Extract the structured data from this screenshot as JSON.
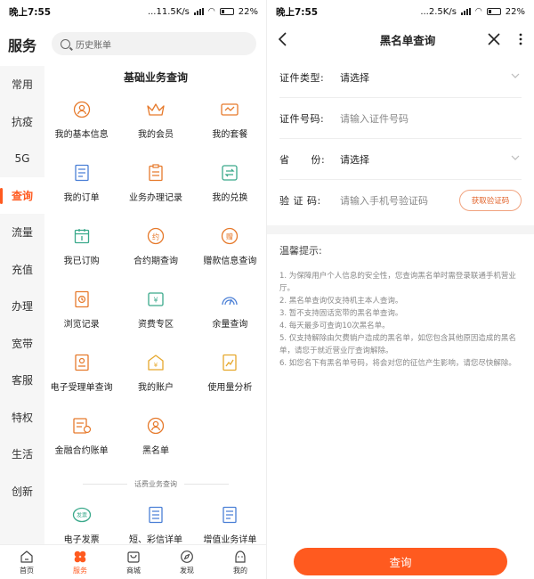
{
  "left": {
    "status": {
      "time": "晚上7:55",
      "speed": "...11.5K/s",
      "battery": "22%"
    },
    "sidebar": {
      "title": "服务",
      "items": [
        {
          "label": "常用"
        },
        {
          "label": "抗疫"
        },
        {
          "label": "5G"
        },
        {
          "label": "查询",
          "active": true
        },
        {
          "label": "流量"
        },
        {
          "label": "充值"
        },
        {
          "label": "办理"
        },
        {
          "label": "宽带"
        },
        {
          "label": "客服"
        },
        {
          "label": "特权"
        },
        {
          "label": "生活"
        },
        {
          "label": "创新"
        }
      ]
    },
    "search": {
      "placeholder": "历史账单"
    },
    "section_title": "基础业务查询",
    "grid": [
      {
        "label": "我的基本信息",
        "icon": "person-icon"
      },
      {
        "label": "我的会员",
        "icon": "crown-icon"
      },
      {
        "label": "我的套餐",
        "icon": "package-icon"
      },
      {
        "label": "我的订单",
        "icon": "order-list-icon"
      },
      {
        "label": "业务办理记录",
        "icon": "clipboard-icon"
      },
      {
        "label": "我的兑换",
        "icon": "exchange-icon"
      },
      {
        "label": "我已订购",
        "icon": "calendar-icon"
      },
      {
        "label": "合约期查询",
        "icon": "contract-icon"
      },
      {
        "label": "赠款信息查询",
        "icon": "gift-money-icon"
      },
      {
        "label": "浏览记录",
        "icon": "history-icon"
      },
      {
        "label": "资费专区",
        "icon": "tariff-icon"
      },
      {
        "label": "余量查询",
        "icon": "gauge-icon"
      },
      {
        "label": "电子受理单查询",
        "icon": "receipt-icon"
      },
      {
        "label": "我的账户",
        "icon": "account-icon"
      },
      {
        "label": "使用量分析",
        "icon": "analysis-icon"
      },
      {
        "label": "金融合约账单",
        "icon": "finance-bill-icon"
      },
      {
        "label": "黑名单",
        "icon": "blacklist-icon"
      }
    ],
    "sub_section_title": "话费业务查询",
    "grid2": [
      {
        "label": "电子发票",
        "icon": "invoice-icon"
      },
      {
        "label": "短、彩信详单",
        "icon": "sms-detail-icon"
      },
      {
        "label": "增值业务详单",
        "icon": "vas-detail-icon"
      }
    ],
    "tabbar": [
      {
        "label": "首页",
        "icon": "home-icon"
      },
      {
        "label": "服务",
        "icon": "service-icon",
        "active": true
      },
      {
        "label": "商城",
        "icon": "shop-icon"
      },
      {
        "label": "发现",
        "icon": "discover-icon"
      },
      {
        "label": "我的",
        "icon": "profile-icon"
      }
    ]
  },
  "right": {
    "status": {
      "time": "晚上7:55",
      "speed": "...2.5K/s",
      "battery": "22%"
    },
    "nav": {
      "title": "黑名单查询"
    },
    "form": {
      "id_type": {
        "label": "证件类型:",
        "value": "请选择"
      },
      "id_number": {
        "label": "证件号码:",
        "placeholder": "请输入证件号码"
      },
      "province": {
        "label": "省      份:",
        "value": "请选择"
      },
      "code": {
        "label": "验 证 码:",
        "placeholder": "请输入手机号验证码",
        "button": "获取验证码"
      }
    },
    "tips": {
      "heading": "温馨提示:",
      "items": [
        "1. 为保障用户个人信息的安全性，您查询黑名单时需登录联通手机营业厅。",
        "2. 黑名单查询仅支持机主本人查询。",
        "3. 暂不支持固话宽带的黑名单查询。",
        "4. 每天最多可查询10次黑名单。",
        "5. 仅支持解除由欠费销户造成的黑名单，如您包含其他原因造成的黑名单，请您于就近营业厅查询解除。",
        "6. 如您名下有黑名单号码，将会对您的征信产生影响，请您尽快解除。"
      ]
    },
    "query_button": "查询",
    "accent": "#ff5a1f"
  }
}
